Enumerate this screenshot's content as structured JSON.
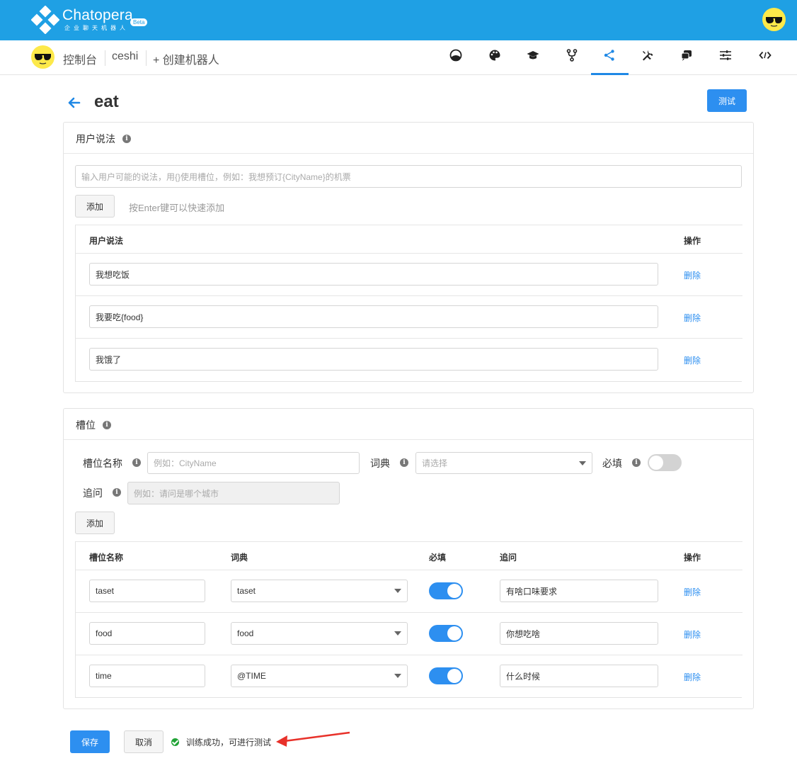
{
  "header": {
    "brand": "Chatopera",
    "brand_sub": "企业聊天机器人",
    "beta": "Beta"
  },
  "nav": {
    "console": "控制台",
    "bot_name": "ceshi",
    "create_bot": "+ 创建机器人",
    "icons": [
      "dashboard-icon",
      "palette-icon",
      "graduation-cap-icon",
      "branch-icon",
      "share-icon",
      "tools-icon",
      "chat-icon",
      "sliders-icon",
      "code-icon"
    ],
    "active_icon": "share-icon"
  },
  "page": {
    "title": "eat",
    "test_button": "测试"
  },
  "utterances": {
    "panel_title": "用户说法",
    "input_placeholder": "输入用户可能的说法，用{}使用槽位，例如：我想预订{CityName}的机票",
    "add_button": "添加",
    "add_hint": "按Enter键可以快速添加",
    "col_utterance": "用户说法",
    "col_action": "操作",
    "delete_label": "删除",
    "rows": [
      "我想吃饭",
      "我要吃{food}",
      "我饿了"
    ]
  },
  "slots": {
    "panel_title": "槽位",
    "name_label": "槽位名称",
    "name_placeholder": "例如：CityName",
    "dict_label": "词典",
    "dict_placeholder": "请选择",
    "required_label": "必填",
    "required_default": false,
    "question_label": "追问",
    "question_placeholder": "例如：请问是哪个城市",
    "add_button": "添加",
    "col_name": "槽位名称",
    "col_dict": "词典",
    "col_required": "必填",
    "col_question": "追问",
    "col_action": "操作",
    "delete_label": "删除",
    "rows": [
      {
        "name": "taset",
        "dict": "taset",
        "required": true,
        "question": "有啥口味要求"
      },
      {
        "name": "food",
        "dict": "food",
        "required": true,
        "question": "你想吃啥"
      },
      {
        "name": "time",
        "dict": "@TIME",
        "required": true,
        "question": "什么时候"
      }
    ]
  },
  "footer": {
    "save_button": "保存",
    "cancel_button": "取消",
    "status_text": "训练成功，可进行测试"
  },
  "colors": {
    "header_blue": "#1fa0e4",
    "primary": "#2d8ff0",
    "success": "#21a336",
    "annotation_arrow": "#e8312a"
  }
}
